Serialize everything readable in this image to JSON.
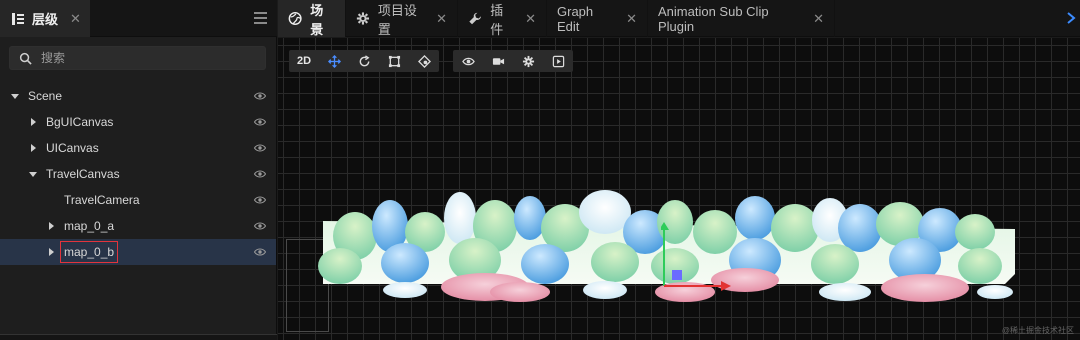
{
  "hierarchy": {
    "tab_label": "层级",
    "close_glyph": "✕",
    "icon": "hierarchy-icon",
    "menu_icon": "menu-icon",
    "search_placeholder": "搜索",
    "tree": [
      {
        "name": "Scene",
        "depth": 0,
        "arrow": "down"
      },
      {
        "name": "BgUICanvas",
        "depth": 1,
        "arrow": "right"
      },
      {
        "name": "UICanvas",
        "depth": 1,
        "arrow": "right"
      },
      {
        "name": "TravelCanvas",
        "depth": 1,
        "arrow": "down"
      },
      {
        "name": "TravelCamera",
        "depth": 2,
        "arrow": "none"
      },
      {
        "name": "map_0_a",
        "depth": 2,
        "arrow": "right"
      },
      {
        "name": "map_0_b",
        "depth": 2,
        "arrow": "right",
        "selected": true,
        "highlighted": true
      }
    ]
  },
  "tabs": [
    {
      "label": "场景",
      "icon": "globe-icon",
      "active": true
    },
    {
      "label": "项目设置",
      "icon": "gear-icon",
      "active": false
    },
    {
      "label": "插件",
      "icon": "wrench-icon",
      "active": false
    },
    {
      "label": "Graph Edit",
      "icon": "",
      "active": false
    },
    {
      "label": "Animation Sub Clip Plugin",
      "icon": "",
      "active": false
    }
  ],
  "toolbar": {
    "mode_label": "2D",
    "tools": [
      "move-icon",
      "rotate-icon",
      "rect-icon",
      "anchor-icon"
    ],
    "view_tools": [
      "eye-icon",
      "camera-icon",
      "gear-icon",
      "play-icon"
    ]
  },
  "watermark": "@稀土掘金技术社区",
  "colors": {
    "selection": "#283448",
    "highlight_border": "#e2343c",
    "axis_y": "#2ecc5a",
    "axis_x": "#e23232",
    "gizmo_center": "#6b6bff"
  }
}
